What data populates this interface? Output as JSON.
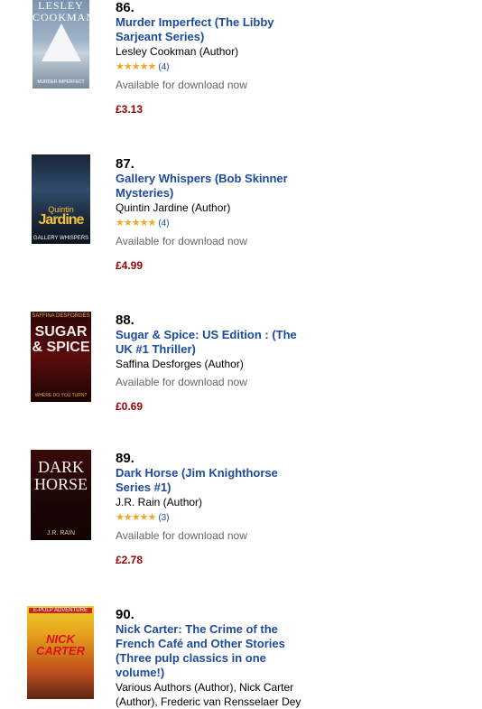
{
  "items": [
    {
      "rank": "86.",
      "title": "Murder Imperfect (The Libby Sarjeant Series)",
      "author": "Lesley Cookman (Author)",
      "stars": "★★★★★",
      "review_count": "(4)",
      "availability": "Available for download now",
      "price": "£3.13",
      "cover": {
        "line1": "LESLEY COOKMAN",
        "line2": "MURDER IMPERFECT"
      }
    },
    {
      "rank": "87.",
      "title": "Gallery Whispers (Bob Skinner Mysteries)",
      "author": "Quintin Jardine (Author)",
      "stars": "★★★★★",
      "review_count": "(4)",
      "availability": "Available for download now",
      "price": "£4.99",
      "cover": {
        "line1": "Quintin",
        "line2": "Jardine",
        "line3": "GALLERY WHISPERS"
      }
    },
    {
      "rank": "88.",
      "title": "Sugar & Spice: US Edition : (The UK #1 Thriller)",
      "author": "Saffina Desforges (Author)",
      "stars": "",
      "review_count": "",
      "availability": "Available for download now",
      "price": "£0.69",
      "cover": {
        "line1": "SAFFINA DESFORGES",
        "line2": "SUGAR & SPICE",
        "line3": "WHERE DO YOU TURN?"
      }
    },
    {
      "rank": "89.",
      "title": "Dark Horse (Jim Knighthorse Series #1)",
      "author": "J.R. Rain (Author)",
      "stars": "★★★★★",
      "review_count": "(3)",
      "availability": "Available for download now",
      "price": "£2.78",
      "cover": {
        "line1": "DARK HORSE",
        "line2": "J.R. RAIN"
      }
    },
    {
      "rank": "90.",
      "title": "Nick Carter: The Crime of the French Café and Other Stories (Three pulp classics in one volume!)",
      "author": "Various Authors (Author), Nick Carter (Author), Frederic van Rensselaer Dey",
      "cover": {
        "line1": "E-PULP ADVENTURE",
        "line2": "NICK CARTER"
      }
    }
  ]
}
